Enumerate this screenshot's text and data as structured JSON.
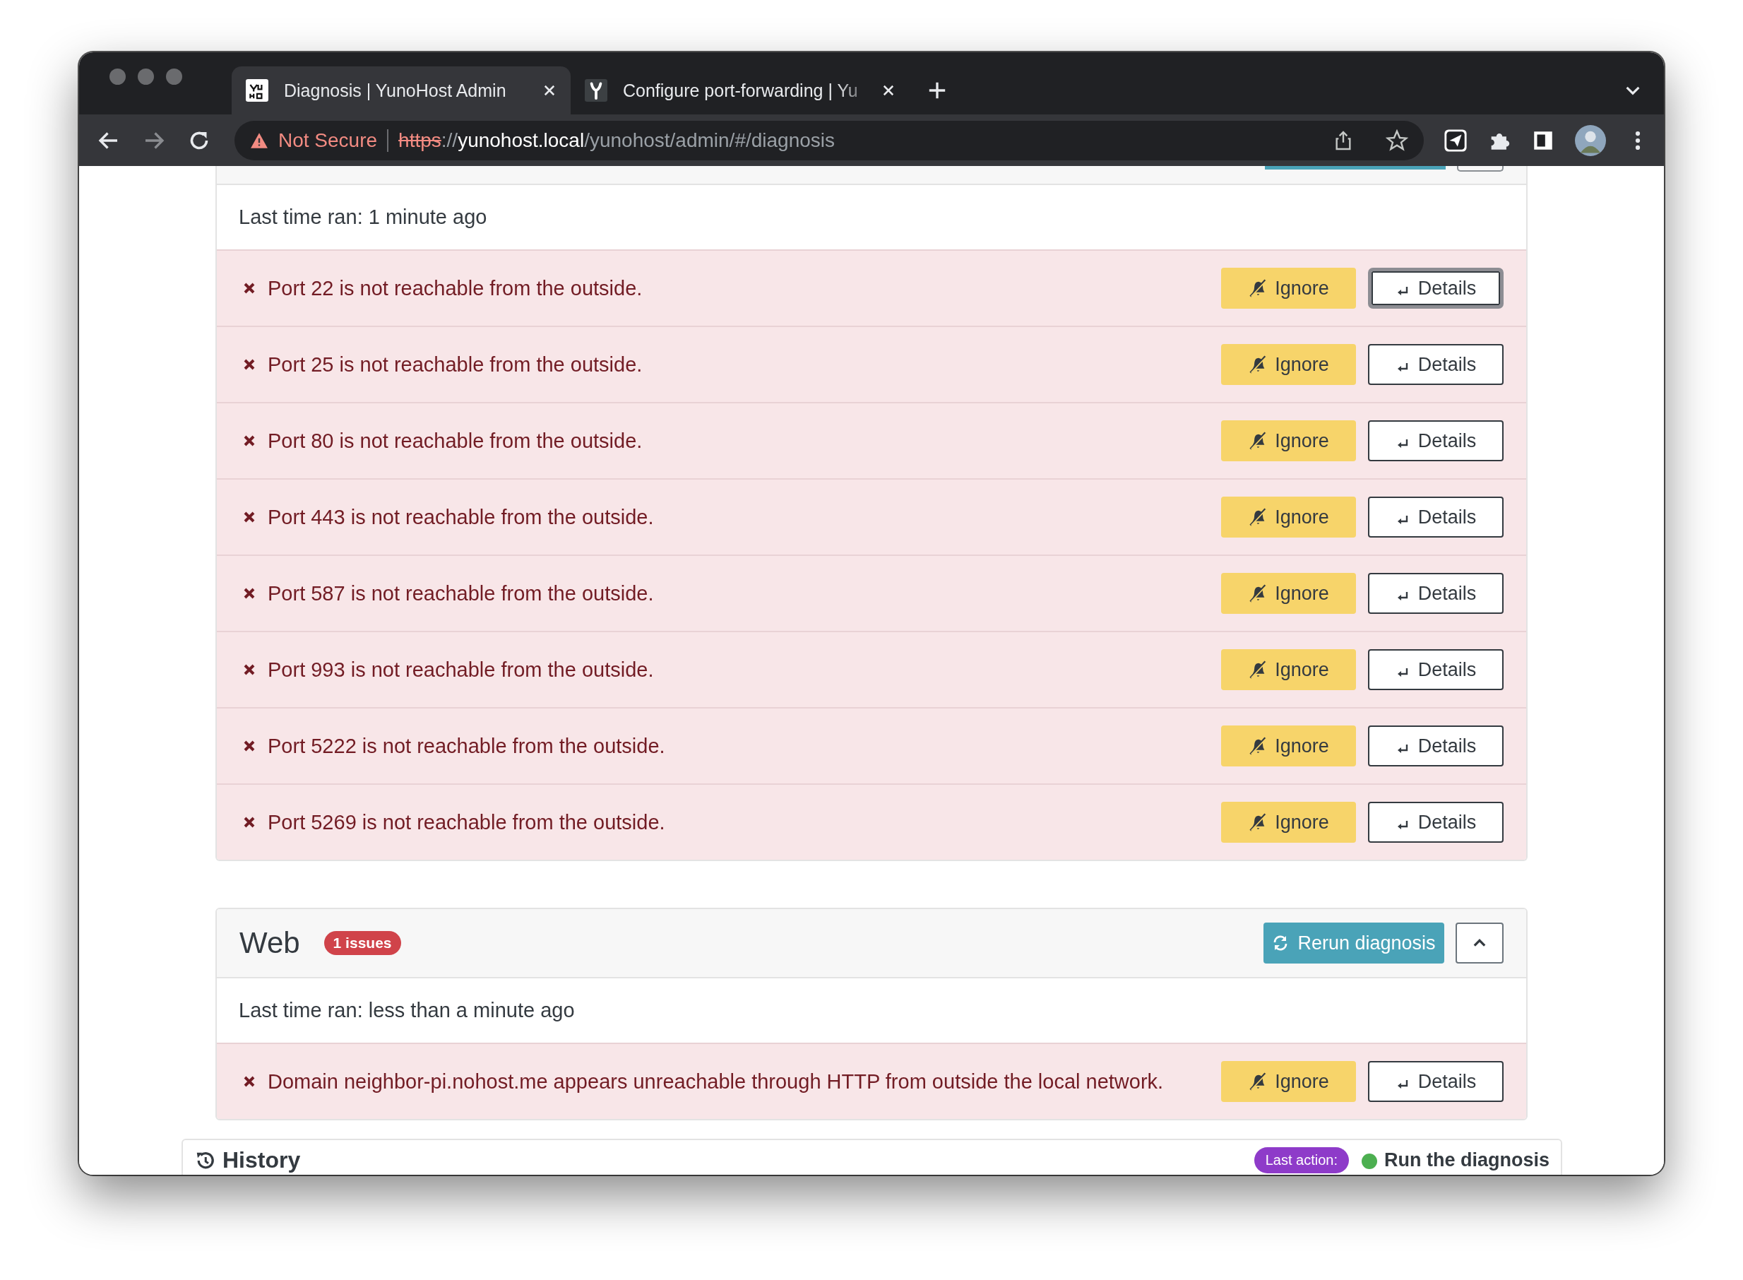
{
  "browser": {
    "tabs": [
      {
        "title": "Diagnosis | YunoHost Admin",
        "selected": true,
        "kind": "logo"
      },
      {
        "title": "Configure port-forwarding | Yu",
        "selected": false,
        "kind": "fork"
      }
    ],
    "address": {
      "security": "Not Secure",
      "parts": [
        {
          "text": "https",
          "kind": "scheme"
        },
        {
          "text": "://",
          "kind": "dim"
        },
        {
          "text": "yunohost.local",
          "kind": "host"
        },
        {
          "text": "/yunohost/admin/#/diagnosis",
          "kind": "dim"
        }
      ]
    }
  },
  "sections": [
    {
      "kind": "clipped",
      "last_run": "Last time ran: 1 minute ago",
      "issues": [
        {
          "text": "Port 22 is not reachable from the outside.",
          "ignore": "Ignore",
          "details": "Details",
          "focused": true
        },
        {
          "text": "Port 25 is not reachable from the outside.",
          "ignore": "Ignore",
          "details": "Details",
          "focused": false
        },
        {
          "text": "Port 80 is not reachable from the outside.",
          "ignore": "Ignore",
          "details": "Details",
          "focused": false
        },
        {
          "text": "Port 443 is not reachable from the outside.",
          "ignore": "Ignore",
          "details": "Details",
          "focused": false
        },
        {
          "text": "Port 587 is not reachable from the outside.",
          "ignore": "Ignore",
          "details": "Details",
          "focused": false
        },
        {
          "text": "Port 993 is not reachable from the outside.",
          "ignore": "Ignore",
          "details": "Details",
          "focused": false
        },
        {
          "text": "Port 5222 is not reachable from the outside.",
          "ignore": "Ignore",
          "details": "Details",
          "focused": false
        },
        {
          "text": "Port 5269 is not reachable from the outside.",
          "ignore": "Ignore",
          "details": "Details",
          "focused": false
        }
      ]
    },
    {
      "kind": "full",
      "title": "Web",
      "badge": "1 issues",
      "rerun": "Rerun diagnosis",
      "last_run": "Last time ran: less than a minute ago",
      "issues": [
        {
          "text": "Domain neighbor-pi.nohost.me appears unreachable through HTTP from outside the local network.",
          "ignore": "Ignore",
          "details": "Details",
          "focused": false
        }
      ]
    }
  ],
  "history": {
    "title": "History",
    "last_action_label": "Last action:",
    "last_action": "Run the diagnosis"
  }
}
